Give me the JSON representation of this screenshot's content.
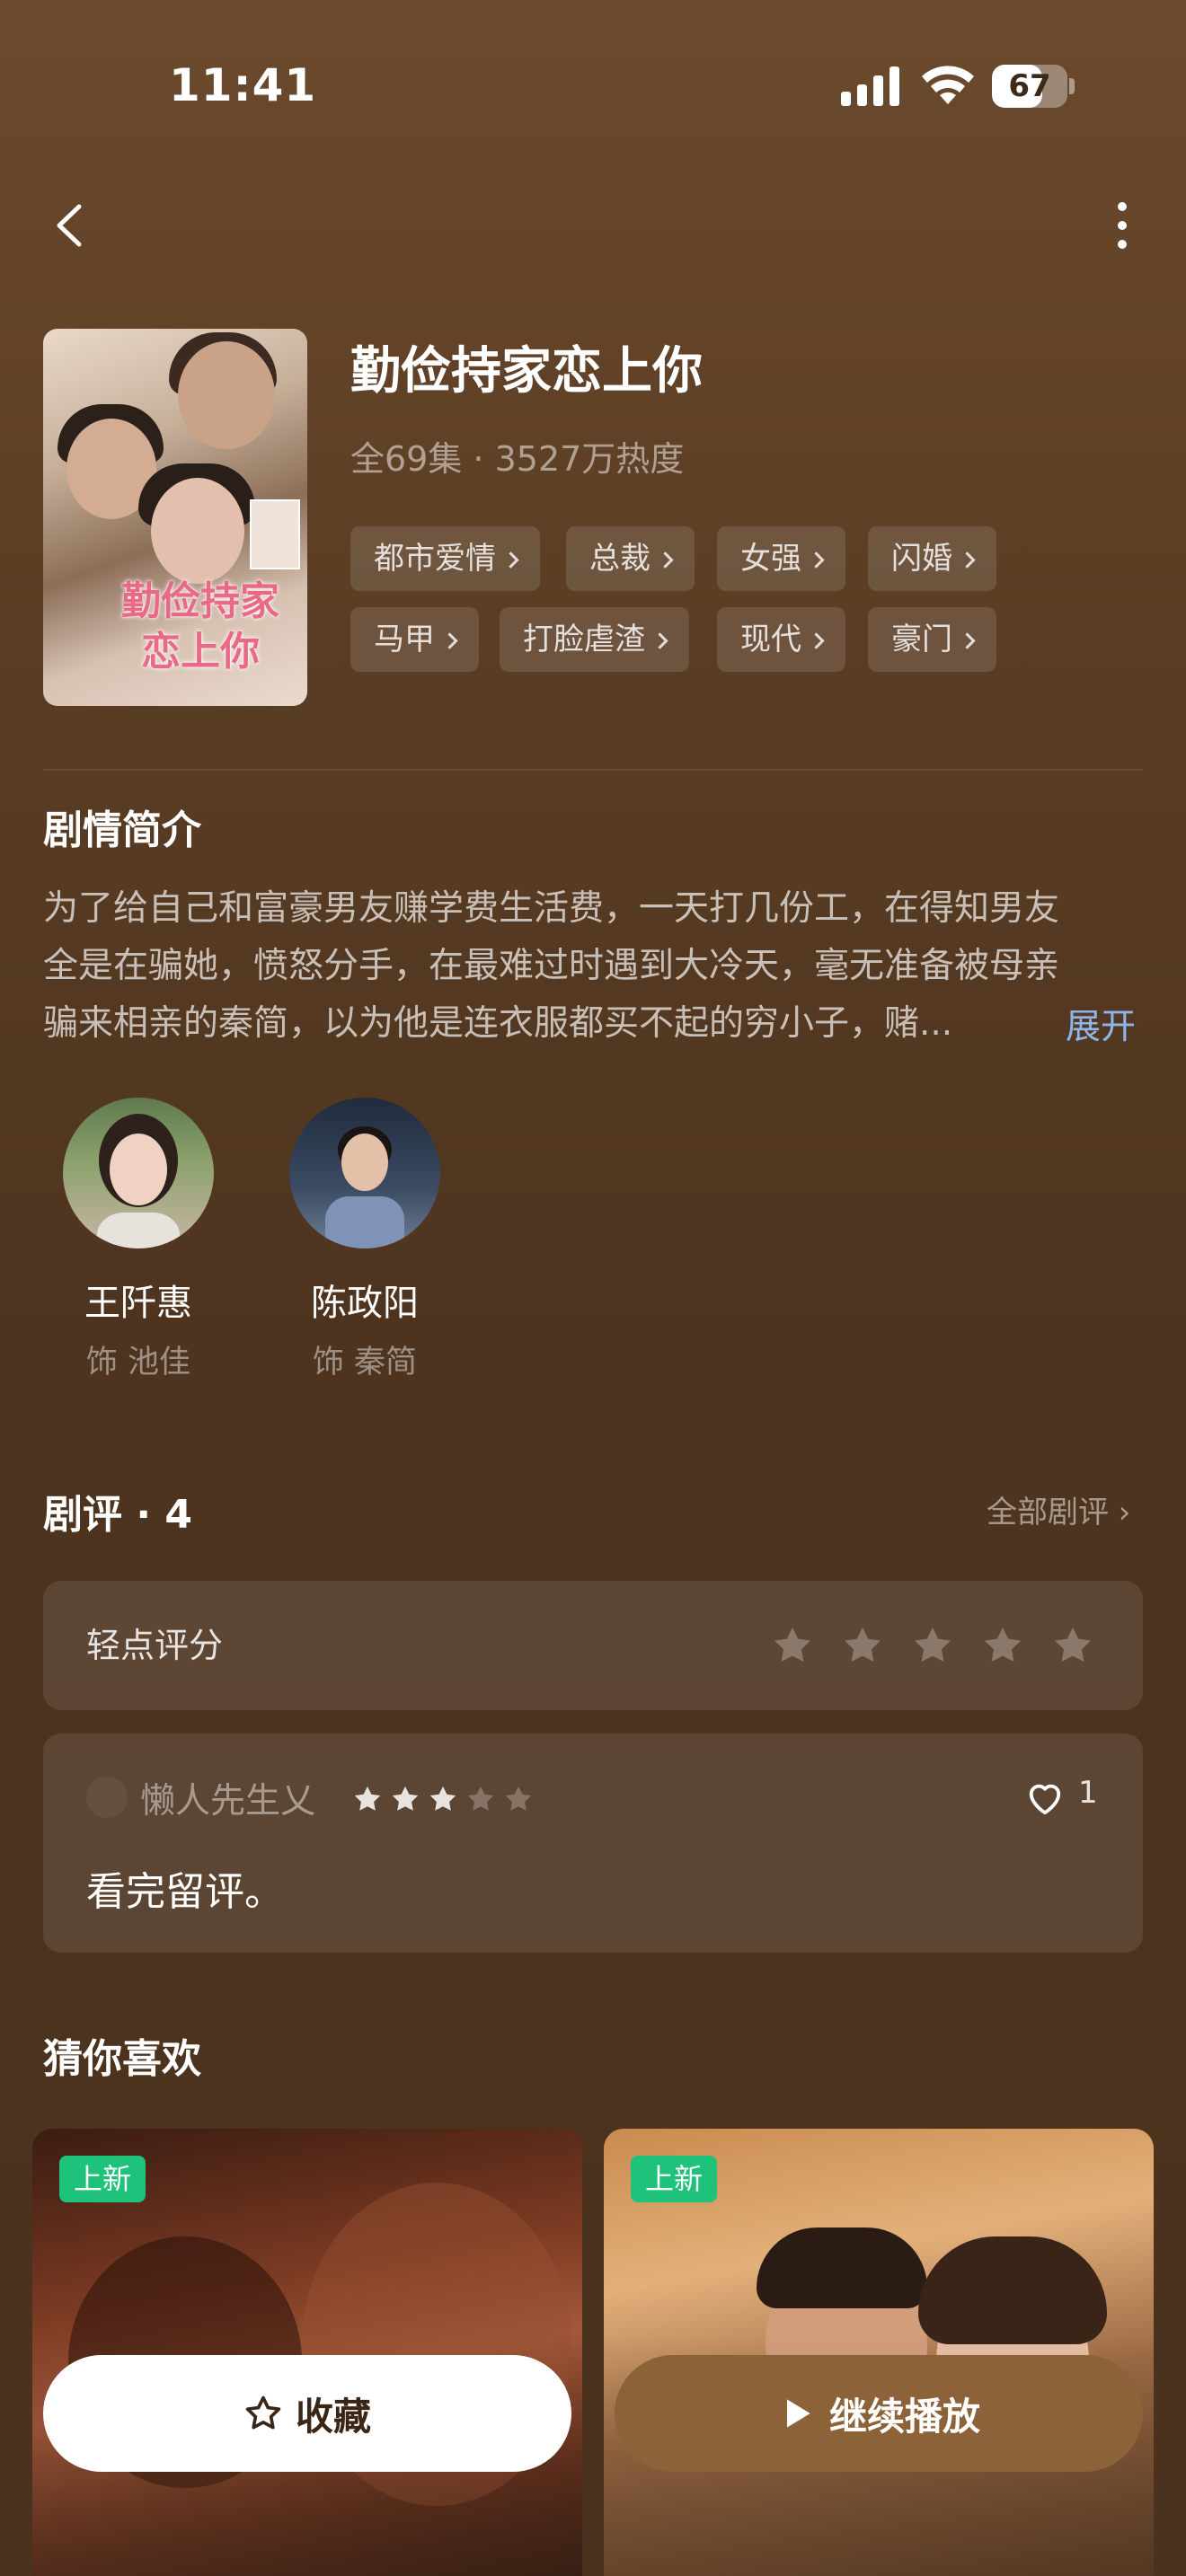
{
  "status_bar": {
    "time": "11:41",
    "battery_percent": "67",
    "battery_level": 0.67
  },
  "drama": {
    "title": "勤俭持家恋上你",
    "poster_title": "勤俭持家恋上你",
    "meta": "全69集 · 3527万热度",
    "tags": [
      "都市爱情",
      "总裁",
      "女强",
      "闪婚",
      "马甲",
      "打脸虐渣",
      "现代",
      "豪门"
    ]
  },
  "synopsis": {
    "heading": "剧情简介",
    "lines": [
      "为了给自己和富豪男友赚学费生活费，一天打几份工，在得知男友",
      "全是在骗她，愤怒分手，在最难过时遇到大冷天，毫无准备被母亲",
      "骗来相亲的秦简，以为他是连衣服都买不起的穷小子，赌..."
    ],
    "expand_label": "展开"
  },
  "cast": [
    {
      "name": "王阡惠",
      "role": "饰 池佳"
    },
    {
      "name": "陈政阳",
      "role": "饰 秦简"
    }
  ],
  "reviews": {
    "heading": "剧评 · 4",
    "all_label": "全部剧评",
    "rate_prompt": "轻点评分",
    "items": [
      {
        "user": "懒人先生乂",
        "rating": 3,
        "max_rating": 5,
        "likes": "1",
        "text": "看完留评。"
      }
    ]
  },
  "recommend": {
    "heading": "猜你喜欢",
    "items": [
      {
        "badge": "上新"
      },
      {
        "badge": "上新"
      }
    ]
  },
  "actions": {
    "collect_label": "收藏",
    "play_label": "继续播放"
  },
  "colors": {
    "accent_link": "#8fb6ea",
    "play_button": "#8c6238",
    "badge_new": "#1fc27a"
  },
  "icons": [
    "chevron-left-icon",
    "more-vertical-icon",
    "star-icon",
    "heart-icon",
    "play-icon",
    "signal-icon",
    "wifi-icon",
    "battery-icon"
  ]
}
